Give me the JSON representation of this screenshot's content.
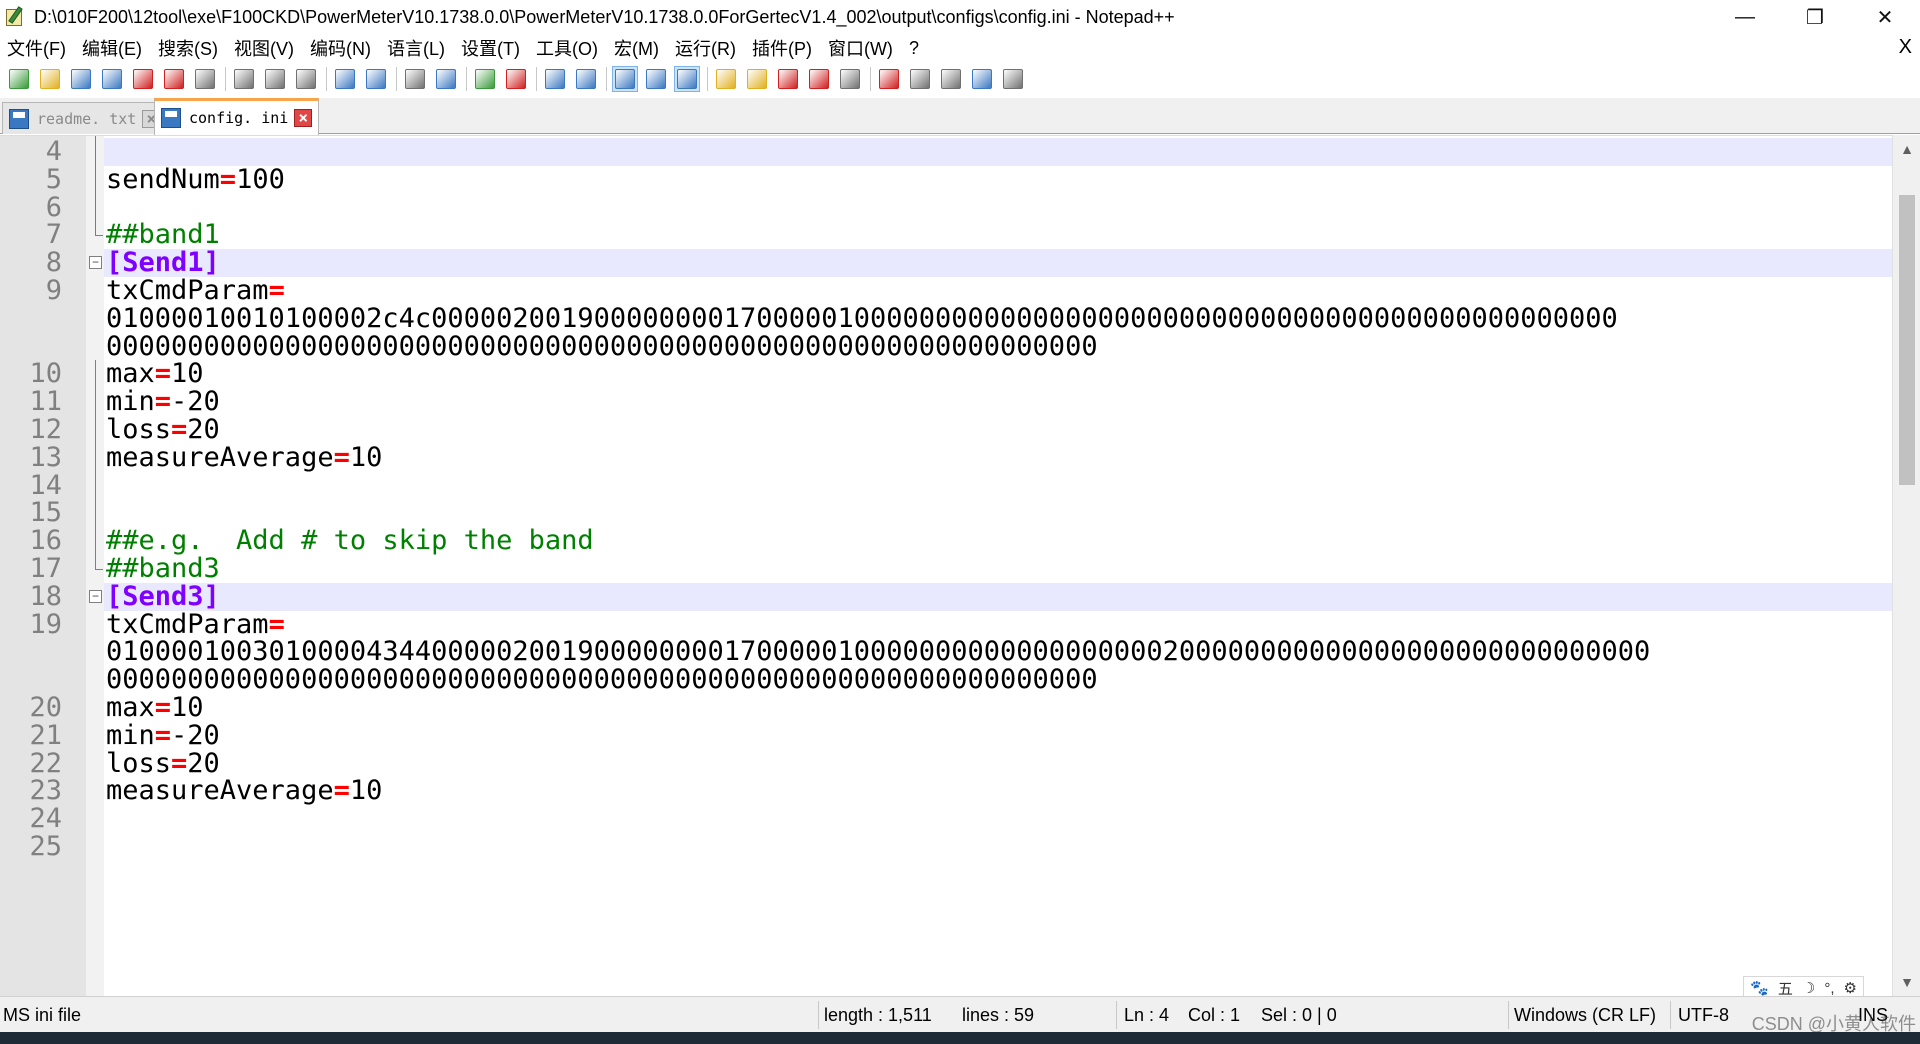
{
  "window": {
    "title": "D:\\010F200\\12tool\\exe\\F100CKD\\PowerMeterV10.1738.0.0\\PowerMeterV10.1738.0.0ForGertecV1.4_002\\output\\configs\\config.ini - Notepad++",
    "minimize_glyph": "—",
    "restore_glyph": "❐",
    "close_glyph": "✕"
  },
  "menu": {
    "items": [
      "文件(F)",
      "编辑(E)",
      "搜索(S)",
      "视图(V)",
      "编码(N)",
      "语言(L)",
      "设置(T)",
      "工具(O)",
      "宏(M)",
      "运行(R)",
      "插件(P)",
      "窗口(W)",
      "?"
    ],
    "close_glyph": "X"
  },
  "toolbar": {
    "icons": [
      "new-file-icon",
      "open-file-icon",
      "save-icon",
      "save-all-icon",
      "close-icon",
      "close-all-icon",
      "print-icon",
      "cut-icon",
      "copy-icon",
      "paste-icon",
      "undo-icon",
      "redo-icon",
      "find-icon",
      "replace-icon",
      "zoom-in-icon",
      "zoom-out-icon",
      "sync-vertical-icon",
      "sync-horizontal-icon",
      "word-wrap-icon",
      "show-all-chars-icon",
      "indent-guide-icon",
      "udl-icon",
      "doc-map-icon",
      "function-list-icon",
      "folder-workspace-icon",
      "monitoring-icon",
      "record-macro-icon",
      "stop-macro-icon",
      "play-macro-icon",
      "run-macro-multiple-icon",
      "save-macro-icon"
    ],
    "colors": {
      "blue": "#3b78c2",
      "green": "#3a9a3a",
      "red": "#d02020",
      "gray": "#707070",
      "yellow": "#e0b020"
    }
  },
  "tabs": [
    {
      "label": "readme. txt",
      "active": false
    },
    {
      "label": "config. ini",
      "active": true
    }
  ],
  "editor": {
    "lines": [
      {
        "num": "4",
        "tokens": [],
        "highlight": true
      },
      {
        "num": "5",
        "tokens": [
          {
            "t": "sendNum",
            "c": "key"
          },
          {
            "t": "=",
            "c": "eq"
          },
          {
            "t": "100",
            "c": "val"
          }
        ]
      },
      {
        "num": "6",
        "tokens": []
      },
      {
        "num": "7",
        "tokens": [
          {
            "t": "##band1",
            "c": "comment"
          }
        ]
      },
      {
        "num": "8",
        "tokens": [
          {
            "t": "[Send1]",
            "c": "section"
          }
        ],
        "highlight": true,
        "fold": true
      },
      {
        "num": "9",
        "tokens": [
          {
            "t": "txCmdParam",
            "c": "key"
          },
          {
            "t": "=",
            "c": "eq"
          }
        ]
      },
      {
        "num": "",
        "tokens": [
          {
            "t": "01000010010100002c4c0000020019000000001700000100000000000000000000000000000000000000000000000",
            "c": "val"
          }
        ]
      },
      {
        "num": "",
        "tokens": [
          {
            "t": "0000000000000000000000000000000000000000000000000000000000000",
            "c": "val"
          }
        ]
      },
      {
        "num": "10",
        "tokens": [
          {
            "t": "max",
            "c": "key"
          },
          {
            "t": "=",
            "c": "eq"
          },
          {
            "t": "10",
            "c": "val"
          }
        ]
      },
      {
        "num": "11",
        "tokens": [
          {
            "t": "min",
            "c": "key"
          },
          {
            "t": "=",
            "c": "eq"
          },
          {
            "t": "-20",
            "c": "val"
          }
        ]
      },
      {
        "num": "12",
        "tokens": [
          {
            "t": "loss",
            "c": "key"
          },
          {
            "t": "=",
            "c": "eq"
          },
          {
            "t": "20",
            "c": "val"
          }
        ]
      },
      {
        "num": "13",
        "tokens": [
          {
            "t": "measureAverage",
            "c": "key"
          },
          {
            "t": "=",
            "c": "eq"
          },
          {
            "t": "10",
            "c": "val"
          }
        ]
      },
      {
        "num": "14",
        "tokens": []
      },
      {
        "num": "15",
        "tokens": []
      },
      {
        "num": "16",
        "tokens": [
          {
            "t": "##e.g.  Add # to skip the band",
            "c": "comment"
          }
        ]
      },
      {
        "num": "17",
        "tokens": [
          {
            "t": "##band3",
            "c": "comment"
          }
        ]
      },
      {
        "num": "18",
        "tokens": [
          {
            "t": "[Send3]",
            "c": "section"
          }
        ],
        "highlight": true,
        "fold": true
      },
      {
        "num": "19",
        "tokens": [
          {
            "t": "txCmdParam",
            "c": "key"
          },
          {
            "t": "=",
            "c": "eq"
          }
        ]
      },
      {
        "num": "",
        "tokens": [
          {
            "t": "01000010030100004344000002001900000000170000010000000000000000000200000000000000000000000000000",
            "c": "val"
          }
        ]
      },
      {
        "num": "",
        "tokens": [
          {
            "t": "0000000000000000000000000000000000000000000000000000000000000",
            "c": "val"
          }
        ]
      },
      {
        "num": "20",
        "tokens": [
          {
            "t": "max",
            "c": "key"
          },
          {
            "t": "=",
            "c": "eq"
          },
          {
            "t": "10",
            "c": "val"
          }
        ]
      },
      {
        "num": "21",
        "tokens": [
          {
            "t": "min",
            "c": "key"
          },
          {
            "t": "=",
            "c": "eq"
          },
          {
            "t": "-20",
            "c": "val"
          }
        ]
      },
      {
        "num": "22",
        "tokens": [
          {
            "t": "loss",
            "c": "key"
          },
          {
            "t": "=",
            "c": "eq"
          },
          {
            "t": "20",
            "c": "val"
          }
        ]
      },
      {
        "num": "23",
        "tokens": [
          {
            "t": "measureAverage",
            "c": "key"
          },
          {
            "t": "=",
            "c": "eq"
          },
          {
            "t": "10",
            "c": "val"
          }
        ]
      },
      {
        "num": "24",
        "tokens": []
      },
      {
        "num": "25",
        "tokens": []
      }
    ],
    "colors": {
      "eq": "#ff0000",
      "comment": "#008000",
      "section": "#8000ff",
      "line_number": "#808080",
      "current_line": "#e8e8ff"
    }
  },
  "scrollbar": {
    "up_glyph": "▲",
    "down_glyph": "▼"
  },
  "ime_bar": {
    "items": [
      "🐾",
      "五",
      "☽",
      "°,",
      "⚙"
    ]
  },
  "statusbar": {
    "file_type": "MS ini file",
    "length": "length : 1,511",
    "lines": "lines : 59",
    "ln": "Ln : 4",
    "col": "Col : 1",
    "sel": "Sel : 0 | 0",
    "eol": "Windows (CR LF)",
    "encoding": "UTF-8",
    "mode": "INS"
  },
  "watermark": "CSDN @小黄人软件"
}
